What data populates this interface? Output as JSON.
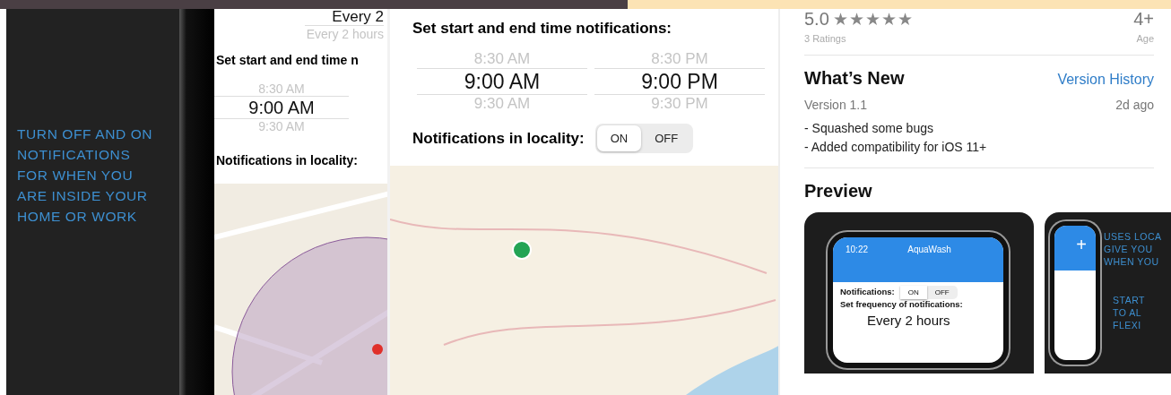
{
  "caption_panel": {
    "lines": [
      "TURN OFF AND ON",
      "NOTIFICATIONS",
      "FOR WHEN YOU",
      "ARE INSIDE YOUR",
      "HOME OR WORK"
    ]
  },
  "phone_crop": {
    "frequency_picker": {
      "selected": "Every 2",
      "next": "Every 2 hours"
    },
    "time_heading": "Set start and end time n",
    "time_picker": {
      "previous": "8:30 AM",
      "selected": "9:00 AM",
      "next": "9:30 AM"
    },
    "locality_label": "Notifications in locality:"
  },
  "settings_screen": {
    "time_heading": "Set start and end time notifications:",
    "pickers": [
      {
        "previous": "8:30 AM",
        "selected": "9:00 AM",
        "next": "9:30 AM"
      },
      {
        "previous": "8:30 PM",
        "selected": "9:00 PM",
        "next": "9:30 PM"
      }
    ],
    "locality_label": "Notifications in locality:",
    "locality_toggle": [
      {
        "label": "ON",
        "selected": true
      },
      {
        "label": "OFF",
        "selected": false
      }
    ]
  },
  "app_store": {
    "rating": "5.0",
    "stars": 5,
    "ratings_count": "3 Ratings",
    "age": "4+",
    "age_label": "Age",
    "whats_new_title": "What’s New",
    "version_history_link": "Version History",
    "version": "Version 1.1",
    "date": "2d ago",
    "notes": [
      "- Squashed some bugs",
      "- Added compatibility for iOS 11+"
    ],
    "preview_title": "Preview",
    "previews": [
      {
        "kind": "settings",
        "time": "10:22",
        "app_name": "AquaWash",
        "toggle": [
          {
            "label": "ON",
            "selected": true
          },
          {
            "label": "OFF",
            "selected": false
          }
        ],
        "notifications_label": "Notifications:",
        "frequency_heading": "Set frequency of notifications:",
        "frequency_value": "Every 2 hours"
      },
      {
        "kind": "caption",
        "add_symbol": "+",
        "lines": [
          "USES LOCA",
          "GIVE YOU",
          "WHEN YOU"
        ],
        "lines_2": [
          "START",
          "TO AL",
          "FLEXI"
        ]
      }
    ]
  }
}
